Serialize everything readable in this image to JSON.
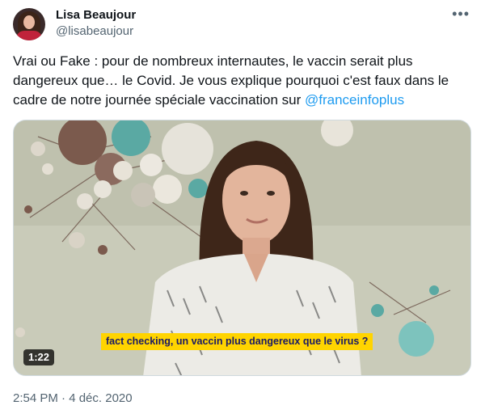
{
  "author": {
    "display_name": "Lisa Beaujour",
    "handle": "@lisabeaujour"
  },
  "menu_icon": "more-horizontal-icon",
  "tweet": {
    "text_before_mention": "Vrai ou Fake : pour de nombreux internautes, le vaccin serait plus dangereux que… le Covid. Je vous explique pourquoi c'est faux dans le cadre de notre journée spéciale vaccination sur ",
    "mention": "@franceinfoplus"
  },
  "video": {
    "duration": "1:22",
    "caption": "fact checking, un vaccin plus dangereux que le virus ?"
  },
  "timestamp": "2:54 PM · 4 déc. 2020",
  "colors": {
    "link": "#1d9bf0",
    "secondary_text": "#536471",
    "caption_bg": "#ffd400",
    "caption_text": "#1a1a66"
  }
}
